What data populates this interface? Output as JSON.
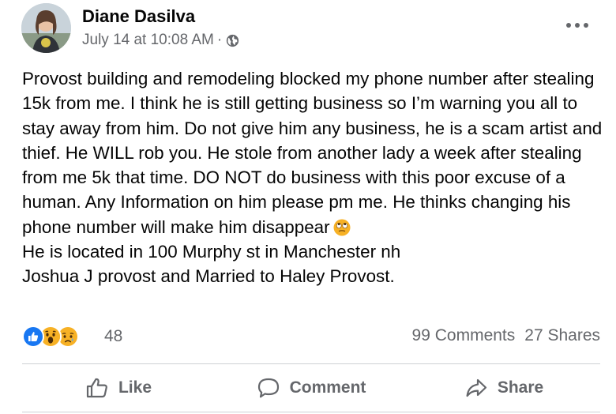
{
  "post": {
    "author": "Diane Dasilva",
    "timestamp": "July 14 at 10:08 AM",
    "separator": "·",
    "privacy_icon": "globe-icon",
    "menu_icon": "more-options-icon",
    "text_main": "Provost building and remodeling blocked my phone number after stealing 15k from me. I think he is still getting business so I’m warning you all to stay away from him. Do not give him any business, he is a scam artist and thief.  He WILL rob you. He stole from another lady a week after stealing from me 5k that time.  DO NOT do business with this poor excuse of a human.  Any Information on him please pm me.  He thinks changing his phone number will make him disappear",
    "text_emoji": "eye-roll-emoji",
    "text_tail": "He is located in 100 Murphy st in Manchester nh\nJoshua J provost and Married to Haley Provost."
  },
  "reactions": {
    "icons": [
      "like-reaction-icon",
      "wow-reaction-icon",
      "sad-reaction-icon"
    ],
    "count": "48"
  },
  "counts": {
    "comments": "99 Comments",
    "shares": "27 Shares"
  },
  "actions": {
    "like": "Like",
    "comment": "Comment",
    "share": "Share"
  },
  "colors": {
    "text": "#050505",
    "secondary": "#65676b",
    "divider": "#ced0d4",
    "like_blue": "#1877f2",
    "reaction_yellow": "#f7b125"
  }
}
